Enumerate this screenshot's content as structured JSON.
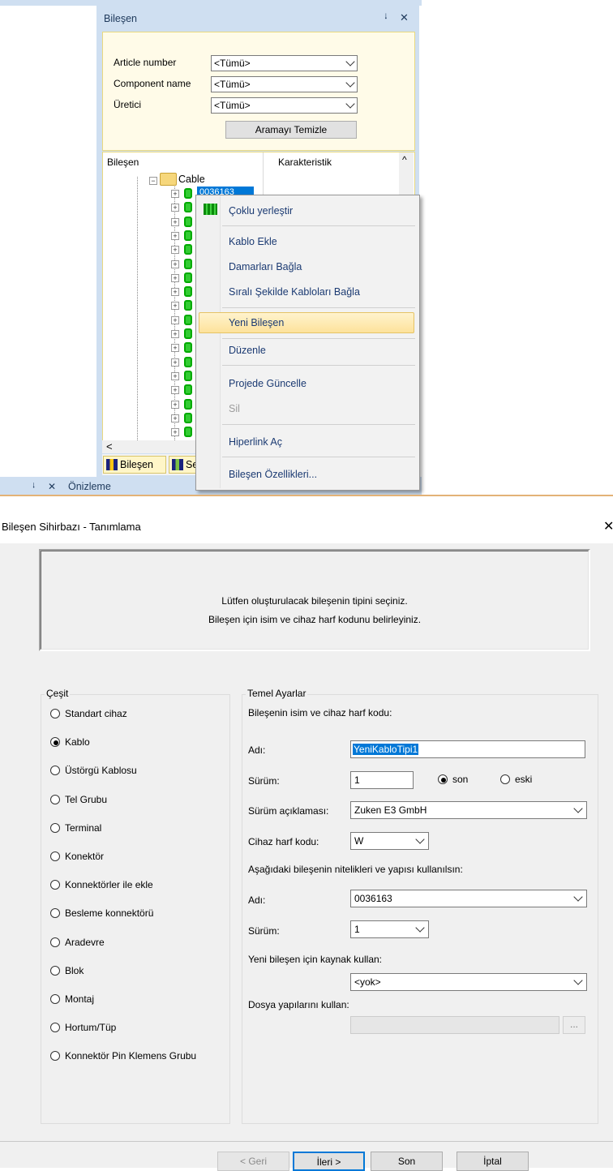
{
  "component_panel": {
    "title": "Bileşen",
    "pin_icon": "pin-icon",
    "close_icon": "close-icon",
    "filters": [
      {
        "label": "Article number",
        "value": "<Tümü>"
      },
      {
        "label": "Component name",
        "value": "<Tümü>"
      },
      {
        "label": "Üretici",
        "value": "<Tümü>"
      }
    ],
    "clear_search_label": "Aramayı Temizle",
    "columns": [
      "Bileşen",
      "Karakteristik"
    ],
    "tree_root": "Cable",
    "selected_item": "0036163",
    "tabs": [
      "Bileşen",
      "Sembol"
    ],
    "bottom_panel_title": "Önizleme"
  },
  "context_menu": {
    "items": [
      {
        "label": "Çoklu yerleştir",
        "enabled": true
      },
      {
        "label": "Kablo Ekle",
        "enabled": true
      },
      {
        "label": "Damarları Bağla",
        "enabled": true
      },
      {
        "label": "Sıralı Şekilde Kabloları Bağla",
        "enabled": true
      },
      {
        "label": "Yeni Bileşen",
        "enabled": true,
        "highlighted": true
      },
      {
        "label": "Düzenle",
        "enabled": true
      },
      {
        "label": "Projede Güncelle",
        "enabled": true
      },
      {
        "label": "Sil",
        "enabled": false
      },
      {
        "label": "Hiperlink Aç",
        "enabled": true
      },
      {
        "label": "Bileşen Özellikleri...",
        "enabled": true
      }
    ]
  },
  "dialog": {
    "title": "Bileşen Sihirbazı - Tanımlama",
    "close_glyph": "✕",
    "info_line1": "Lütfen oluşturulacak bileşenin tipini seçiniz.",
    "info_line2": "Bileşen için isim ve cihaz harf kodunu belirleyiniz.",
    "type_group_label": "Çeşit",
    "types": [
      "Standart cihaz",
      "Kablo",
      "Üstörgü Kablosu",
      "Tel Grubu",
      "Terminal",
      "Konektör",
      "Konnektörler ile ekle",
      "Besleme konnektörü",
      "Aradevre",
      "Blok",
      "Montaj",
      "Hortum/Tüp",
      "Konnektör Pin Klemens Grubu"
    ],
    "selected_type": "Kablo",
    "settings_group_label": "Temel Ayarlar",
    "name_code_caption": "Bileşenin isim ve cihaz harf kodu:",
    "name_label": "Adı:",
    "name_value": "YeniKabloTipi1",
    "version_label": "Sürüm:",
    "version_value": "1",
    "version_options": [
      "son",
      "eski"
    ],
    "version_selected": "son",
    "version_desc_label": "Sürüm açıklaması:",
    "version_desc_value": "Zuken E3 GmbH",
    "device_code_label": "Cihaz harf kodu:",
    "device_code_value": "W",
    "use_component_caption": "Aşağıdaki bileşenin nitelikleri ve yapısı kullanılsın:",
    "ref_name_label": "Adı:",
    "ref_name_value": "0036163",
    "ref_version_label": "Sürüm:",
    "ref_version_value": "1",
    "source_caption": "Yeni bileşen için kaynak kullan:",
    "source_value": "<yok>",
    "file_structure_caption": "Dosya yapılarını kullan:",
    "file_structure_value": "",
    "browse_label": "...",
    "buttons": {
      "back": "< Geri",
      "next": "İleri >",
      "finish": "Son",
      "cancel": "İptal"
    }
  }
}
